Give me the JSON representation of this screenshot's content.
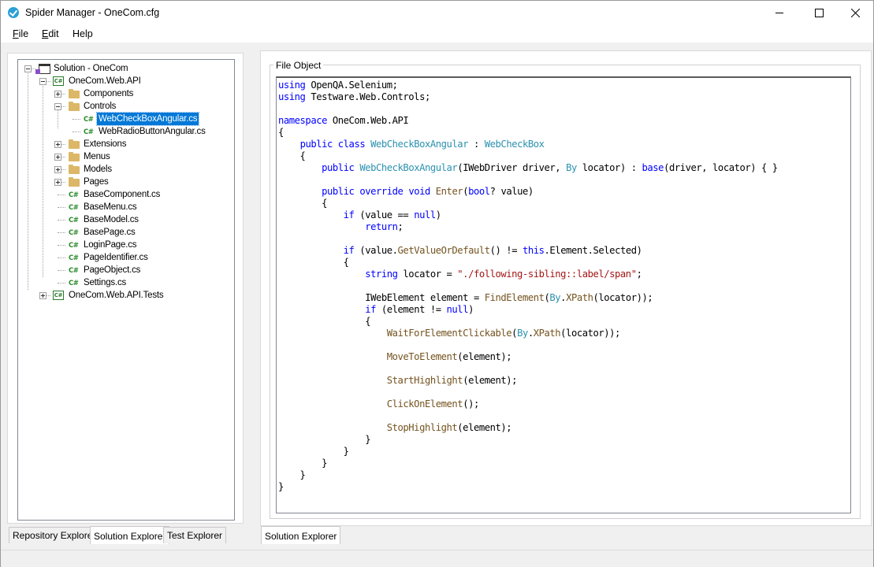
{
  "window": {
    "title": "Spider Manager - OneCom.cfg"
  },
  "menu": [
    {
      "accel": "F",
      "rest": "ile"
    },
    {
      "accel": "E",
      "rest": "dit"
    },
    {
      "accel": "",
      "rest": "Help"
    }
  ],
  "tree": [
    {
      "label": "Solution - OneCom",
      "icon": "solution",
      "level": 0,
      "expander": "minus"
    },
    {
      "label": "OneCom.Web.API",
      "icon": "csproj",
      "level": 1,
      "expander": "minus"
    },
    {
      "label": "Components",
      "icon": "folder",
      "level": 2,
      "expander": "plus"
    },
    {
      "label": "Controls",
      "icon": "folder",
      "level": 2,
      "expander": "minus"
    },
    {
      "label": "WebCheckBoxAngular.cs",
      "icon": "cs",
      "level": 3,
      "selected": true
    },
    {
      "label": "WebRadioButtonAngular.cs",
      "icon": "cs",
      "level": 3
    },
    {
      "label": "Extensions",
      "icon": "folder",
      "level": 2,
      "expander": "plus"
    },
    {
      "label": "Menus",
      "icon": "folder",
      "level": 2,
      "expander": "plus"
    },
    {
      "label": "Models",
      "icon": "folder",
      "level": 2,
      "expander": "plus"
    },
    {
      "label": "Pages",
      "icon": "folder",
      "level": 2,
      "expander": "plus"
    },
    {
      "label": "BaseComponent.cs",
      "icon": "cs",
      "level": 2
    },
    {
      "label": "BaseMenu.cs",
      "icon": "cs",
      "level": 2
    },
    {
      "label": "BaseModel.cs",
      "icon": "cs",
      "level": 2
    },
    {
      "label": "BasePage.cs",
      "icon": "cs",
      "level": 2
    },
    {
      "label": "LoginPage.cs",
      "icon": "cs",
      "level": 2
    },
    {
      "label": "PageIdentifier.cs",
      "icon": "cs",
      "level": 2
    },
    {
      "label": "PageObject.cs",
      "icon": "cs",
      "level": 2
    },
    {
      "label": "Settings.cs",
      "icon": "cs",
      "level": 2
    },
    {
      "label": "OneCom.Web.API.Tests",
      "icon": "csproj",
      "level": 1,
      "expander": "plus"
    }
  ],
  "left_tabs": [
    {
      "label": "Repository Explorer",
      "active": false
    },
    {
      "label": "Solution Explorer",
      "active": true
    },
    {
      "label": "Test Explorer",
      "active": false
    }
  ],
  "right_tabs": [
    {
      "label": "Solution Explorer",
      "active": true
    }
  ],
  "group_title": "File Object",
  "syntax_colors": {
    "kw": "#0000ff",
    "type": "#2b91af",
    "str": "#a31515",
    "method": "#74531f",
    "text": "#000000",
    "selection": "#0078d7"
  },
  "code_lines": [
    [
      [
        "kw",
        "using"
      ],
      [
        "text",
        " OpenQA.Selenium;"
      ]
    ],
    [
      [
        "kw",
        "using"
      ],
      [
        "text",
        " Testware.Web.Controls;"
      ]
    ],
    [],
    [
      [
        "kw",
        "namespace"
      ],
      [
        "text",
        " OneCom.Web.API"
      ]
    ],
    [
      [
        "text",
        "{"
      ]
    ],
    [
      [
        "text",
        "    "
      ],
      [
        "kw",
        "public"
      ],
      [
        "text",
        " "
      ],
      [
        "kw",
        "class"
      ],
      [
        "text",
        " "
      ],
      [
        "type",
        "WebCheckBoxAngular"
      ],
      [
        "text",
        " : "
      ],
      [
        "type",
        "WebCheckBox"
      ]
    ],
    [
      [
        "text",
        "    {"
      ]
    ],
    [
      [
        "text",
        "        "
      ],
      [
        "kw",
        "public"
      ],
      [
        "text",
        " "
      ],
      [
        "type",
        "WebCheckBoxAngular"
      ],
      [
        "text",
        "(IWebDriver driver, "
      ],
      [
        "type",
        "By"
      ],
      [
        "text",
        " locator) : "
      ],
      [
        "kw",
        "base"
      ],
      [
        "text",
        "(driver, locator) { }"
      ]
    ],
    [],
    [
      [
        "text",
        "        "
      ],
      [
        "kw",
        "public"
      ],
      [
        "text",
        " "
      ],
      [
        "kw",
        "override"
      ],
      [
        "text",
        " "
      ],
      [
        "kw",
        "void"
      ],
      [
        "text",
        " "
      ],
      [
        "method",
        "Enter"
      ],
      [
        "text",
        "("
      ],
      [
        "kw",
        "bool"
      ],
      [
        "text",
        "? value)"
      ]
    ],
    [
      [
        "text",
        "        {"
      ]
    ],
    [
      [
        "text",
        "            "
      ],
      [
        "kw",
        "if"
      ],
      [
        "text",
        " (value == "
      ],
      [
        "kw",
        "null"
      ],
      [
        "text",
        ")"
      ]
    ],
    [
      [
        "text",
        "                "
      ],
      [
        "kw",
        "return"
      ],
      [
        "text",
        ";"
      ]
    ],
    [],
    [
      [
        "text",
        "            "
      ],
      [
        "kw",
        "if"
      ],
      [
        "text",
        " (value."
      ],
      [
        "method",
        "GetValueOrDefault"
      ],
      [
        "text",
        "() != "
      ],
      [
        "kw",
        "this"
      ],
      [
        "text",
        ".Element.Selected)"
      ]
    ],
    [
      [
        "text",
        "            {"
      ]
    ],
    [
      [
        "text",
        "                "
      ],
      [
        "kw",
        "string"
      ],
      [
        "text",
        " locator = "
      ],
      [
        "str",
        "\"./following-sibling::label/span\""
      ],
      [
        "text",
        ";"
      ]
    ],
    [],
    [
      [
        "text",
        "                IWebElement element = "
      ],
      [
        "method",
        "FindElement"
      ],
      [
        "text",
        "("
      ],
      [
        "type",
        "By"
      ],
      [
        "text",
        "."
      ],
      [
        "method",
        "XPath"
      ],
      [
        "text",
        "(locator));"
      ]
    ],
    [
      [
        "text",
        "                "
      ],
      [
        "kw",
        "if"
      ],
      [
        "text",
        " (element != "
      ],
      [
        "kw",
        "null"
      ],
      [
        "text",
        ")"
      ]
    ],
    [
      [
        "text",
        "                {"
      ]
    ],
    [
      [
        "text",
        "                    "
      ],
      [
        "method",
        "WaitForElementClickable"
      ],
      [
        "text",
        "("
      ],
      [
        "type",
        "By"
      ],
      [
        "text",
        "."
      ],
      [
        "method",
        "XPath"
      ],
      [
        "text",
        "(locator));"
      ]
    ],
    [],
    [
      [
        "text",
        "                    "
      ],
      [
        "method",
        "MoveToElement"
      ],
      [
        "text",
        "(element);"
      ]
    ],
    [],
    [
      [
        "text",
        "                    "
      ],
      [
        "method",
        "StartHighlight"
      ],
      [
        "text",
        "(element);"
      ]
    ],
    [],
    [
      [
        "text",
        "                    "
      ],
      [
        "method",
        "ClickOnElement"
      ],
      [
        "text",
        "();"
      ]
    ],
    [],
    [
      [
        "text",
        "                    "
      ],
      [
        "method",
        "StopHighlight"
      ],
      [
        "text",
        "(element);"
      ]
    ],
    [
      [
        "text",
        "                }"
      ]
    ],
    [
      [
        "text",
        "            }"
      ]
    ],
    [
      [
        "text",
        "        }"
      ]
    ],
    [
      [
        "text",
        "    }"
      ]
    ],
    [
      [
        "text",
        "}"
      ]
    ]
  ]
}
